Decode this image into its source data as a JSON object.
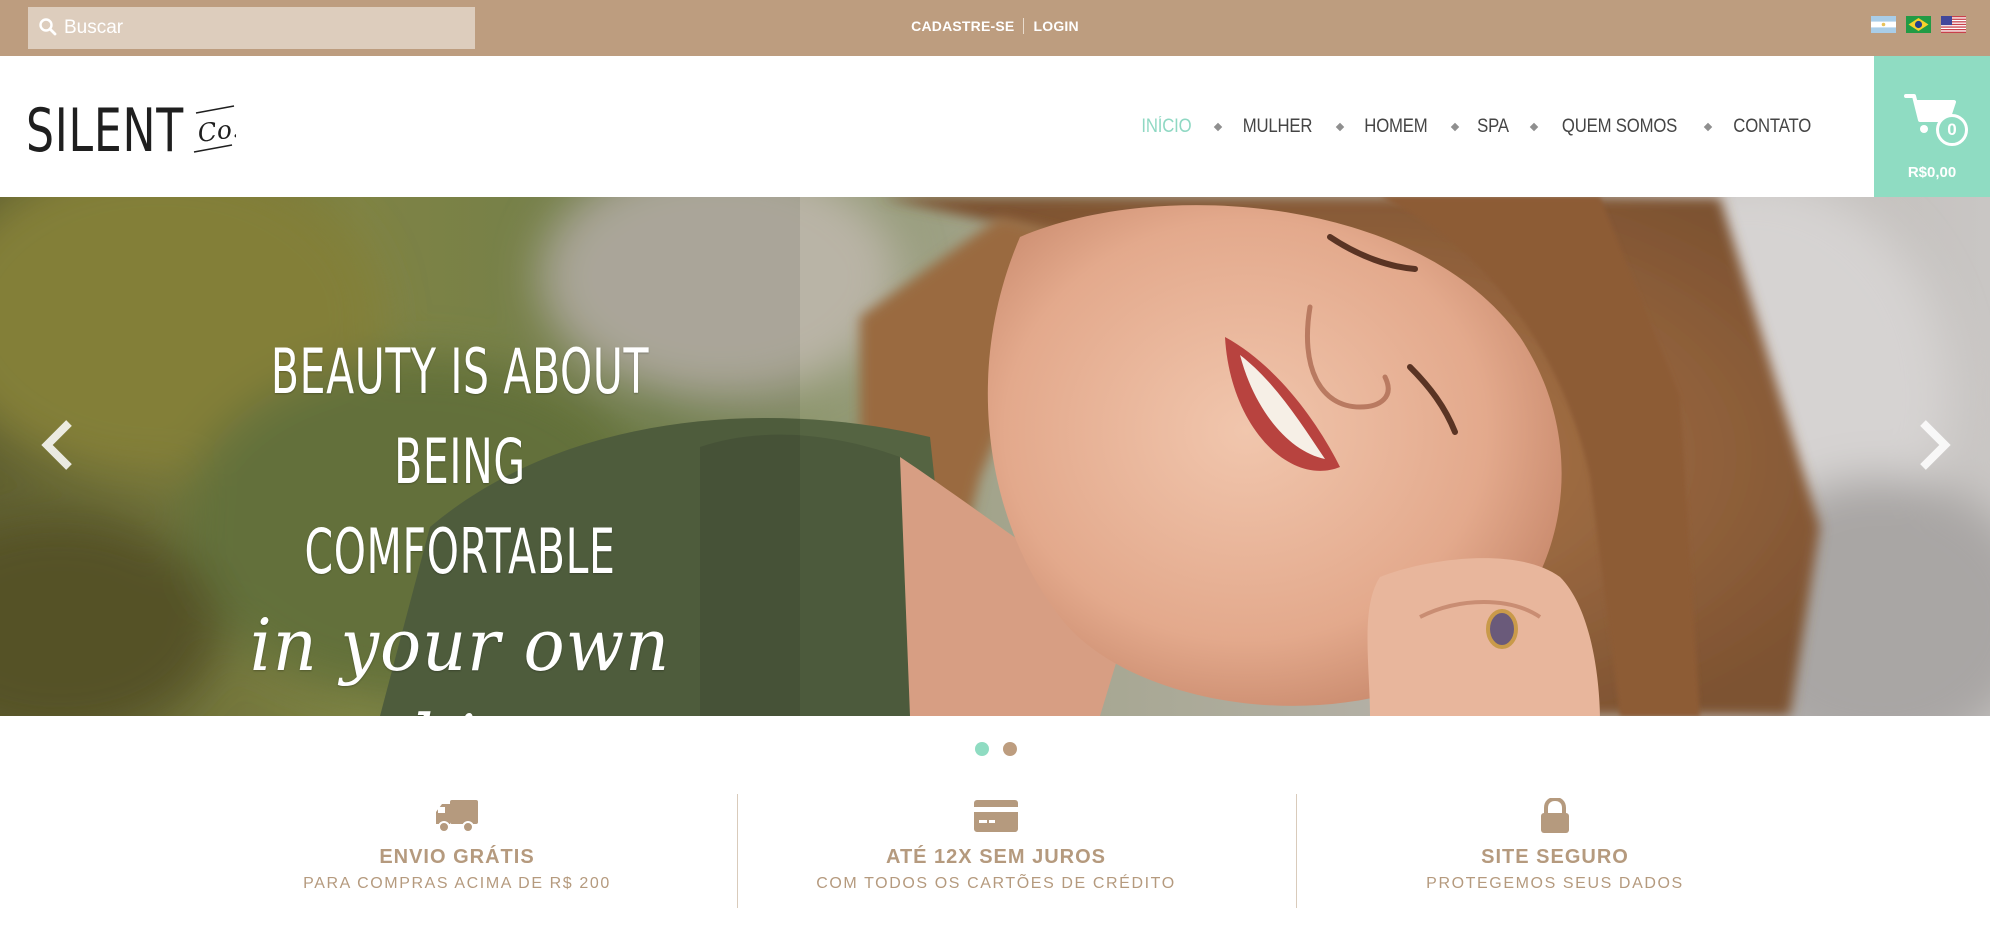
{
  "colors": {
    "topbar": "#bd9d7f",
    "accent": "#8fdcc2",
    "nav_text": "#454545",
    "feature_text": "#b59a7e"
  },
  "topbar": {
    "search": {
      "placeholder": "Buscar",
      "value": ""
    },
    "auth": {
      "register": "CADASTRE-SE",
      "login": "LOGIN"
    },
    "flags": [
      "argentina-flag-icon",
      "brazil-flag-icon",
      "usa-flag-icon"
    ]
  },
  "header": {
    "logo": {
      "main": "SILENT",
      "suffix": "Co."
    },
    "nav": [
      {
        "label": "INÍCIO",
        "active": true
      },
      {
        "label": "MULHER",
        "active": false
      },
      {
        "label": "HOMEM",
        "active": false
      },
      {
        "label": "SPA",
        "active": false
      },
      {
        "label": "QUEM SOMOS",
        "active": false
      },
      {
        "label": "CONTATO",
        "active": false
      }
    ],
    "cart": {
      "count": "0",
      "total": "R$0,00",
      "icon": "cart-icon"
    }
  },
  "hero": {
    "line1": "BEAUTY IS ABOUT",
    "line2": "BEING COMFORTABLE",
    "line3": "in your own skin.",
    "slides": 2,
    "active_slide": 1
  },
  "features": [
    {
      "icon": "truck-icon",
      "title": "ENVIO GRÁTIS",
      "subtitle": "PARA COMPRAS ACIMA DE R$ 200"
    },
    {
      "icon": "credit-card-icon",
      "title": "ATÉ 12X SEM JUROS",
      "subtitle": "COM TODOS OS CARTÕES DE CRÉDITO"
    },
    {
      "icon": "lock-icon",
      "title": "SITE SEGURO",
      "subtitle": "PROTEGEMOS SEUS DADOS"
    }
  ]
}
